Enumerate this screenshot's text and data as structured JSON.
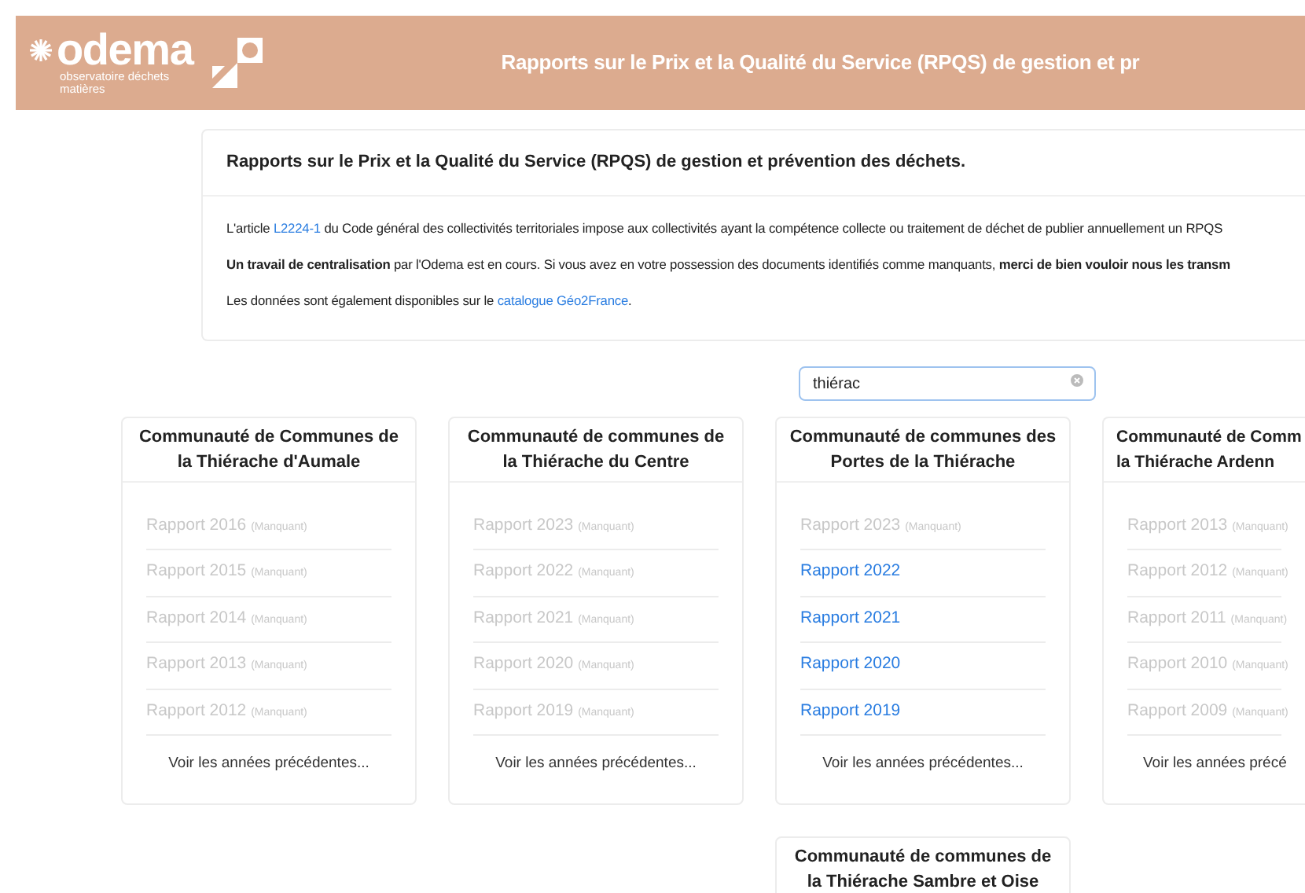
{
  "header": {
    "logo_name": "odema",
    "logo_tagline": "observatoire déchets matières",
    "title": "Rapports sur le Prix et la Qualité du Service (RPQS) de gestion et pr"
  },
  "intro": {
    "title": "Rapports sur le Prix et la Qualité du Service (RPQS) de gestion et prévention des déchets.",
    "paragraphs": [
      {
        "before": "L'article ",
        "link": "L2224-1",
        "after": " du Code général des collectivités territoriales impose aux collectivités ayant la compétence collecte ou traitement de déchet de publier annuellement un RPQS"
      },
      {
        "before": "**Un travail de centralisation** par l'Odema est en cours. Si vous avez en votre possession des documents identifiés comme manquants, **merci de bien vouloir nous les transm**"
      },
      {
        "before": "Les données sont également disponibles sur le ",
        "link": "catalogue Géo2France",
        "after": "."
      }
    ]
  },
  "search": {
    "value": "thiérac"
  },
  "cards": [
    {
      "title": "Communauté de Communes de la Thiérache d'Aumale",
      "items": [
        {
          "label": "Rapport 2016",
          "note": "(Manquant)",
          "missing": true
        },
        {
          "label": "Rapport 2015",
          "note": "(Manquant)",
          "missing": true
        },
        {
          "label": "Rapport 2014",
          "note": "(Manquant)",
          "missing": true
        },
        {
          "label": "Rapport 2013",
          "note": "(Manquant)",
          "missing": true
        },
        {
          "label": "Rapport 2012",
          "note": "(Manquant)",
          "missing": true
        }
      ],
      "more": "Voir les années précédentes..."
    },
    {
      "title": "Communauté de communes de la Thiérache du Centre",
      "items": [
        {
          "label": "Rapport 2023",
          "note": "(Manquant)",
          "missing": true
        },
        {
          "label": "Rapport 2022",
          "note": "(Manquant)",
          "missing": true
        },
        {
          "label": "Rapport 2021",
          "note": "(Manquant)",
          "missing": true
        },
        {
          "label": "Rapport 2020",
          "note": "(Manquant)",
          "missing": true
        },
        {
          "label": "Rapport 2019",
          "note": "(Manquant)",
          "missing": true
        }
      ],
      "more": "Voir les années précédentes..."
    },
    {
      "title": "Communauté de communes des Portes de la Thiérache",
      "items": [
        {
          "label": "Rapport 2023",
          "note": "(Manquant)",
          "missing": true
        },
        {
          "label": "Rapport 2022",
          "missing": false
        },
        {
          "label": "Rapport 2021",
          "missing": false
        },
        {
          "label": "Rapport 2020",
          "missing": false
        },
        {
          "label": "Rapport 2019",
          "missing": false
        }
      ],
      "more": "Voir les années précédentes..."
    },
    {
      "title": "Communauté de Comm",
      "title_2": "la Thiérache Ardenn",
      "items": [
        {
          "label": "Rapport 2013",
          "note": "(Manquant)",
          "missing": true
        },
        {
          "label": "Rapport 2012",
          "note": "(Manquant)",
          "missing": true
        },
        {
          "label": "Rapport 2011",
          "note": "(Manquant)",
          "missing": true
        },
        {
          "label": "Rapport 2010",
          "note": "(Manquant)",
          "missing": true
        },
        {
          "label": "Rapport 2009",
          "note": "(Manquant)",
          "missing": true
        }
      ],
      "more": "Voir les années précé"
    },
    {
      "title": "Communauté de communes de la Thiérache Sambre et Oise"
    }
  ]
}
